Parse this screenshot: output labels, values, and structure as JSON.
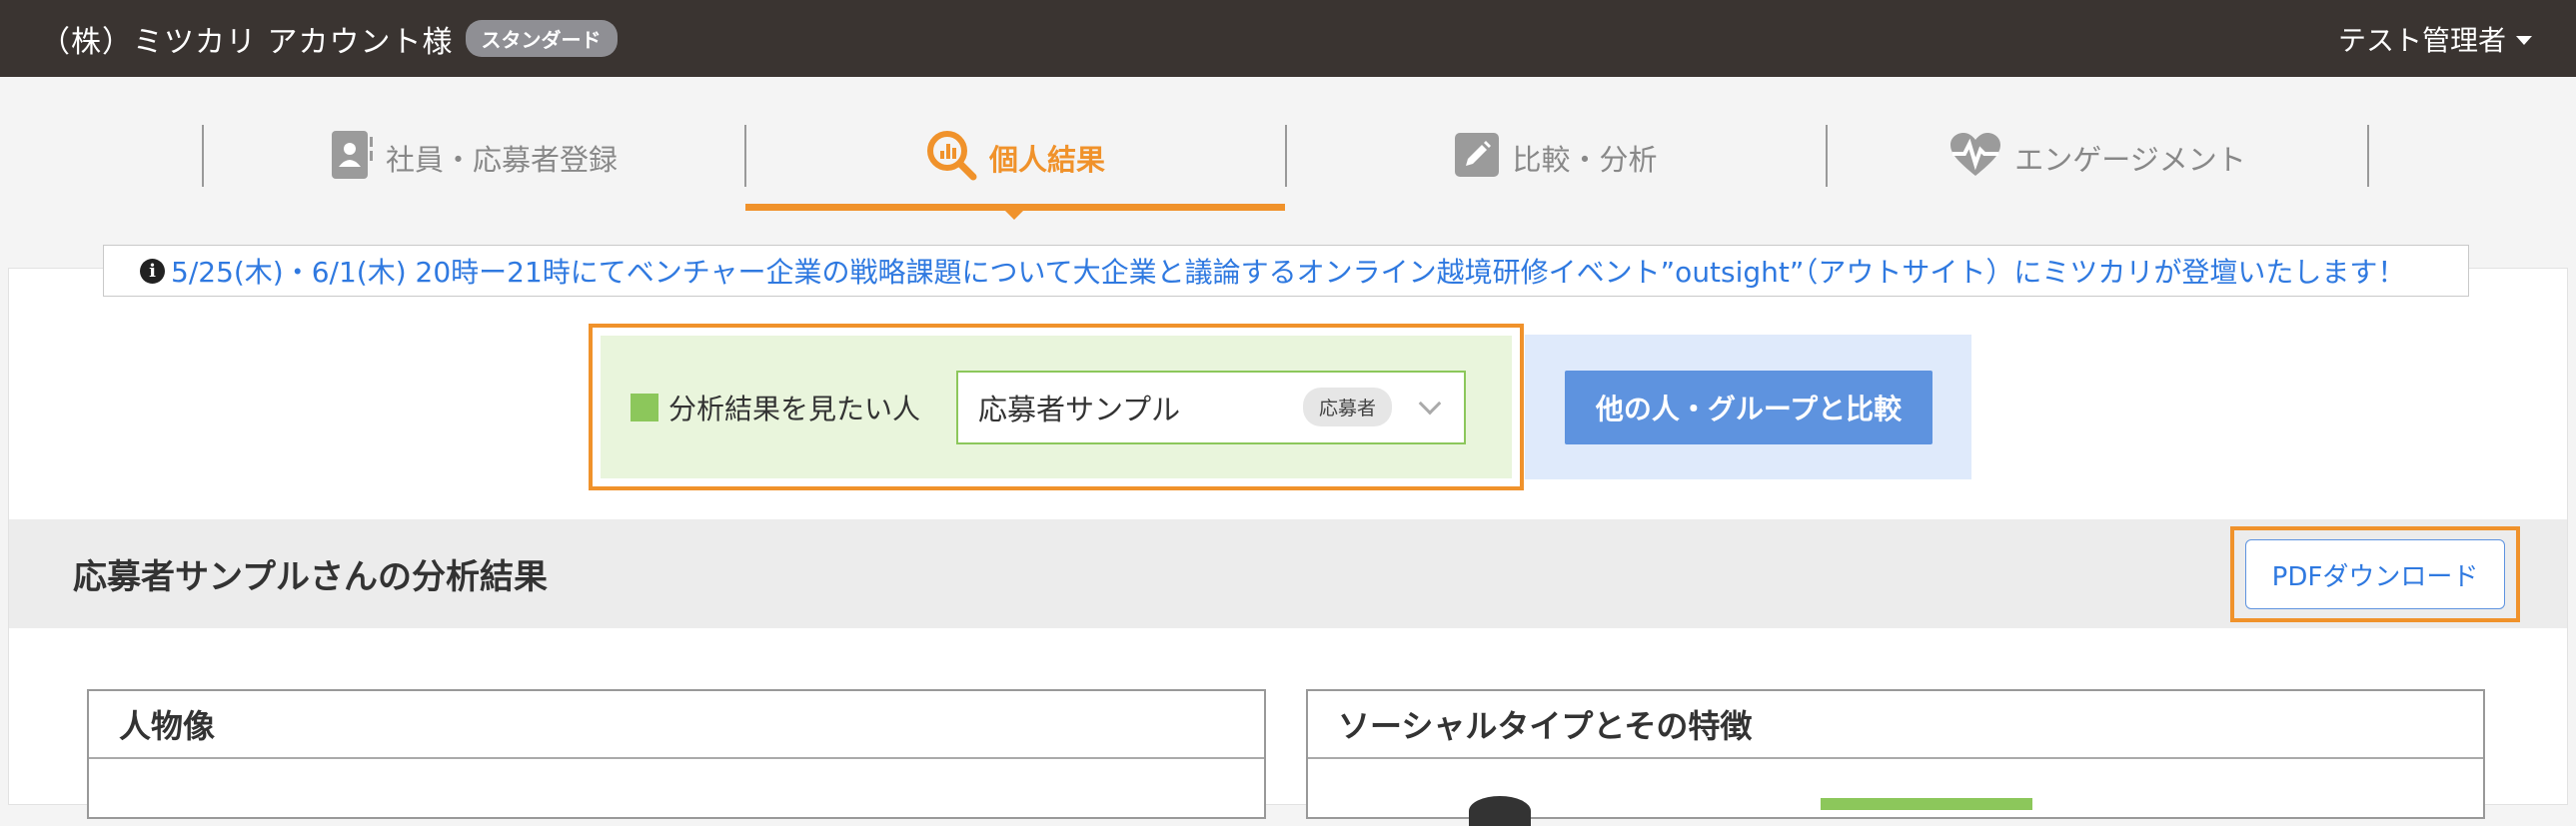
{
  "header": {
    "company": "（株）ミツカリ アカウント様",
    "plan_badge": "スタンダード",
    "user_menu": "テスト管理者"
  },
  "tabs": [
    {
      "label": "社員・応募者登録",
      "icon": "person-card-icon",
      "active": false
    },
    {
      "label": "個人結果",
      "icon": "search-chart-icon",
      "active": true
    },
    {
      "label": "比較・分析",
      "icon": "pencil-icon",
      "active": false
    },
    {
      "label": "エンゲージメント",
      "icon": "heart-pulse-icon",
      "active": false
    }
  ],
  "notice": {
    "text": "5/25(木)・6/1(木) 20時ー21時にてベンチャー企業の戦略課題について大企業と議論するオンライン越境研修イベント”outsight”（アウトサイト）にミツカリが登壇いたします！"
  },
  "selector": {
    "label": "分析結果を見たい人",
    "selected_value": "応募者サンプル",
    "role_badge": "応募者",
    "compare_button": "他の人・グループと比較"
  },
  "result": {
    "title": "応募者サンプルさんの分析結果",
    "pdf_button": "PDFダウンロード"
  },
  "cards": [
    {
      "title": "人物像"
    },
    {
      "title": "ソーシャルタイプとその特徴"
    }
  ],
  "colors": {
    "accent": "#f0922b",
    "primary": "#5e93df",
    "green": "#8cc75b",
    "topbar": "#3a3431"
  }
}
